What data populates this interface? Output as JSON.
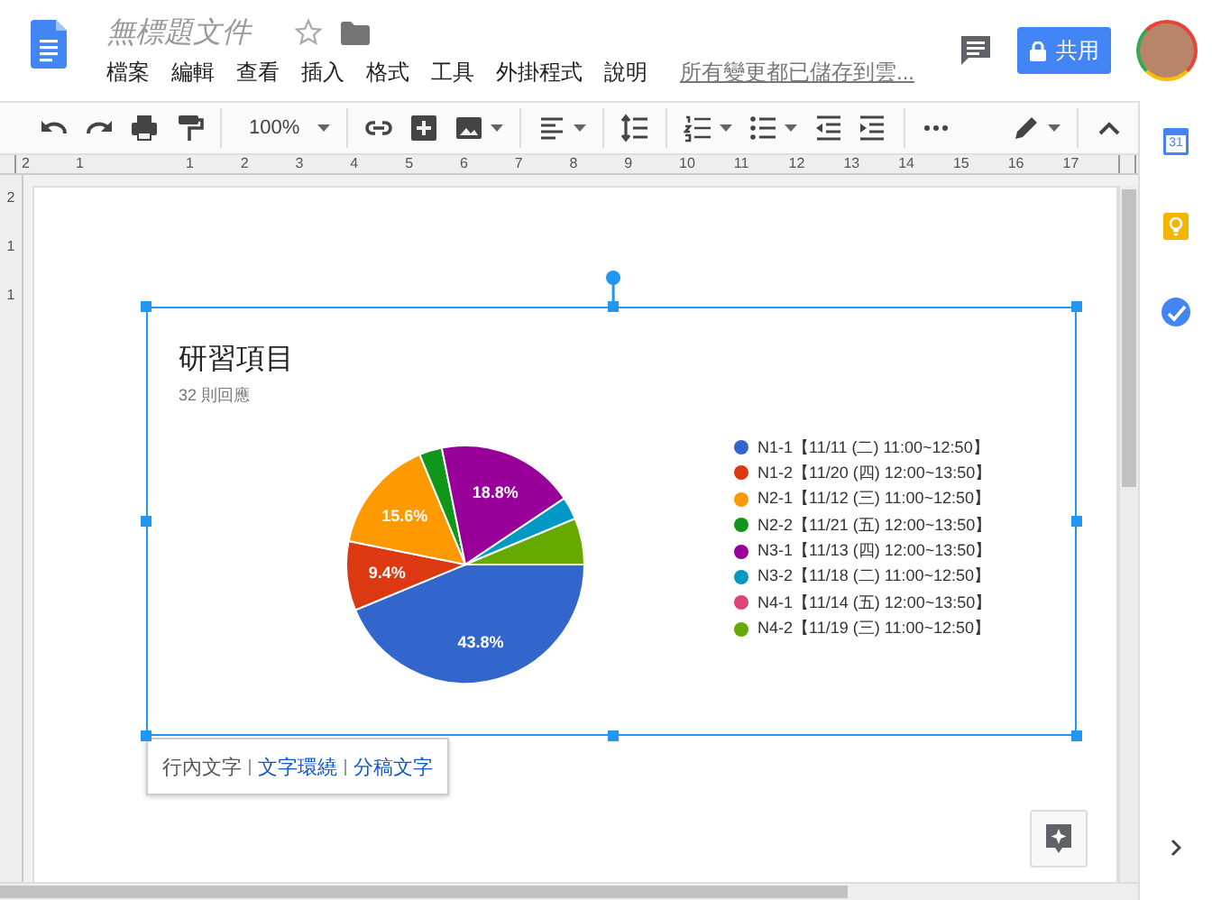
{
  "document": {
    "title": "無標題文件",
    "save_status": "所有變更都已儲存到雲..."
  },
  "menu": [
    "檔案",
    "編輯",
    "查看",
    "插入",
    "格式",
    "工具",
    "外掛程式",
    "說明"
  ],
  "share_button": {
    "label": "共用"
  },
  "toolbar": {
    "zoom": "100%"
  },
  "top_ruler": {
    "labels": [
      "2",
      "1",
      "1",
      "2",
      "3",
      "4",
      "5",
      "6",
      "7",
      "8",
      "9",
      "10",
      "11",
      "12",
      "13",
      "14",
      "15",
      "16",
      "17"
    ]
  },
  "left_ruler": {
    "labels": [
      "2",
      "1",
      "1"
    ]
  },
  "chart": {
    "title": "研習項目",
    "subtitle": "32 則回應",
    "chart_data": {
      "type": "pie",
      "categories": [
        "N1-1【11/11 (二) 11:00~12:50】",
        "N1-2【11/20 (四) 12:00~13:50】",
        "N2-1【11/12 (三) 11:00~12:50】",
        "N2-2【11/21 (五) 12:00~13:50】",
        "N3-1【11/13 (四) 12:00~13:50】",
        "N3-2【11/18 (二) 11:00~12:50】",
        "N4-1【11/14 (五) 12:00~13:50】",
        "N4-2【11/19 (三) 11:00~12:50】"
      ],
      "legend": "right",
      "series": [
        {
          "colors": [
            "#3366cc",
            "#dc3912",
            "#ff9900",
            "#109618",
            "#990099",
            "#0099c6",
            "#dd4477",
            "#66aa00"
          ],
          "values": [
            43.8,
            9.4,
            15.6,
            3.1,
            18.8,
            3.1,
            0,
            6.3
          ]
        }
      ],
      "value_labels": [
        "43.8%",
        "9.4%",
        "15.6%",
        null,
        "18.8%",
        null,
        null,
        null
      ]
    }
  },
  "side_panel": {
    "calendar_day": "31"
  },
  "wrap_options": [
    {
      "label": "行內文字",
      "selected": true
    },
    {
      "label": "文字環繞",
      "selected": false
    },
    {
      "label": "分稿文字",
      "selected": false
    }
  ]
}
